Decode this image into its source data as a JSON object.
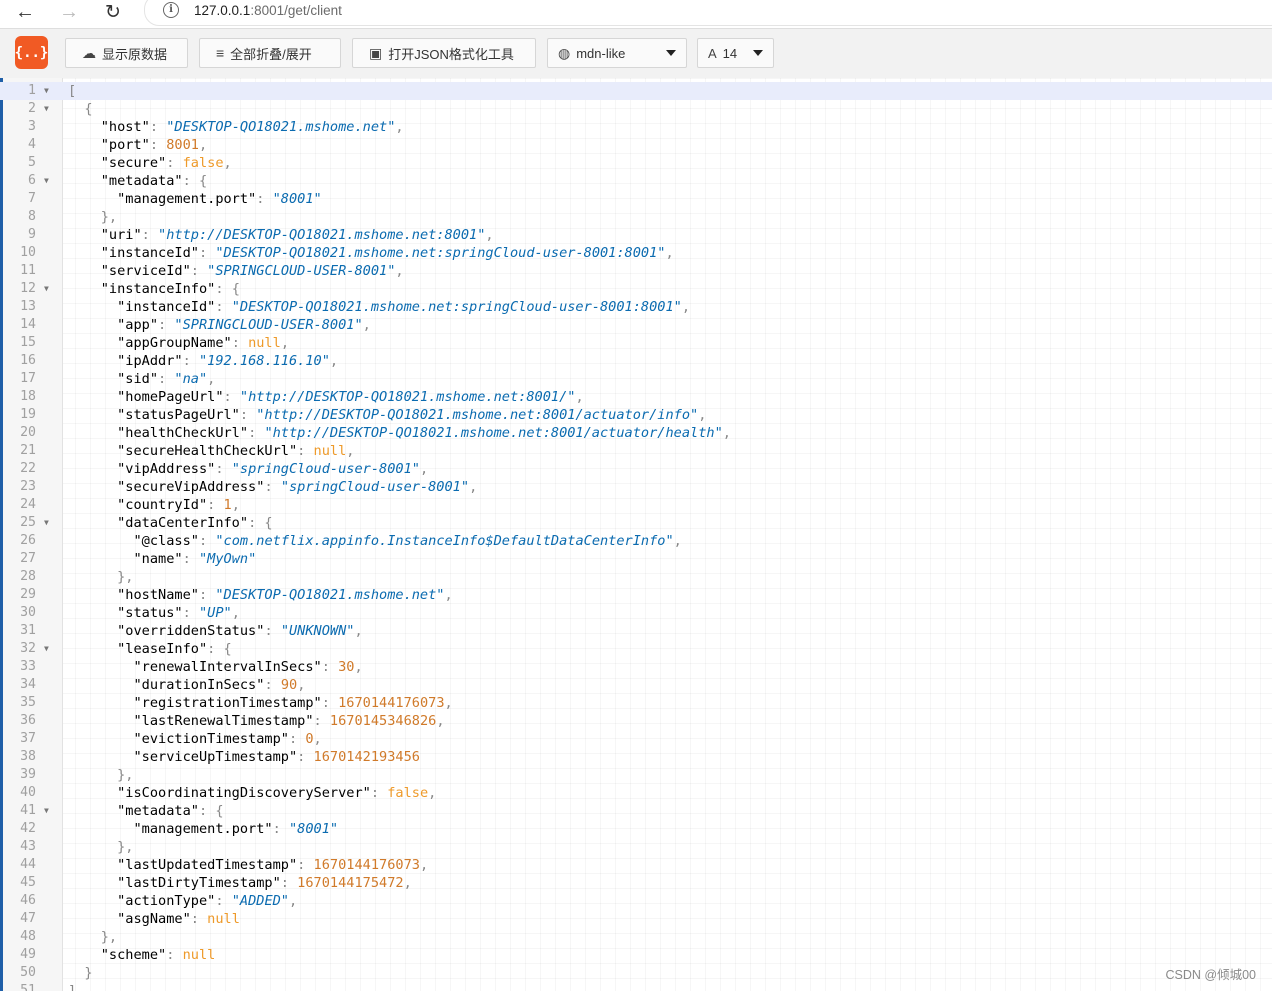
{
  "browser": {
    "url_host": "127.0.0.1",
    "url_path": ":8001/get/client"
  },
  "toolbar": {
    "logo": "{..}",
    "raw_label": "显示原数据",
    "fold_label": "全部折叠/展开",
    "tool_label": "打开JSON格式化工具",
    "theme_value": "mdn-like",
    "font_size_value": "14"
  },
  "editor": {
    "lines": [
      {
        "n": "1",
        "fold": true,
        "indent": 0,
        "parts": [
          [
            "p",
            "["
          ]
        ]
      },
      {
        "n": "2",
        "fold": true,
        "indent": 1,
        "parts": [
          [
            "p",
            "{"
          ]
        ]
      },
      {
        "n": "3",
        "fold": false,
        "indent": 2,
        "parts": [
          [
            "k",
            "\"host\""
          ],
          [
            "p",
            ": "
          ],
          [
            "s",
            "\"DESKTOP-QO18021.mshome.net\""
          ],
          [
            "p",
            ","
          ]
        ]
      },
      {
        "n": "4",
        "fold": false,
        "indent": 2,
        "parts": [
          [
            "k",
            "\"port\""
          ],
          [
            "p",
            ": "
          ],
          [
            "n",
            "8001"
          ],
          [
            "p",
            ","
          ]
        ]
      },
      {
        "n": "5",
        "fold": false,
        "indent": 2,
        "parts": [
          [
            "k",
            "\"secure\""
          ],
          [
            "p",
            ": "
          ],
          [
            "b",
            "false"
          ],
          [
            "p",
            ","
          ]
        ]
      },
      {
        "n": "6",
        "fold": true,
        "indent": 2,
        "parts": [
          [
            "k",
            "\"metadata\""
          ],
          [
            "p",
            ": {"
          ]
        ]
      },
      {
        "n": "7",
        "fold": false,
        "indent": 3,
        "parts": [
          [
            "k",
            "\"management.port\""
          ],
          [
            "p",
            ": "
          ],
          [
            "s",
            "\"8001\""
          ]
        ]
      },
      {
        "n": "8",
        "fold": false,
        "indent": 2,
        "parts": [
          [
            "p",
            "},"
          ]
        ]
      },
      {
        "n": "9",
        "fold": false,
        "indent": 2,
        "parts": [
          [
            "k",
            "\"uri\""
          ],
          [
            "p",
            ": "
          ],
          [
            "s",
            "\"http://DESKTOP-QO18021.mshome.net:8001\""
          ],
          [
            "p",
            ","
          ]
        ]
      },
      {
        "n": "10",
        "fold": false,
        "indent": 2,
        "parts": [
          [
            "k",
            "\"instanceId\""
          ],
          [
            "p",
            ": "
          ],
          [
            "s",
            "\"DESKTOP-QO18021.mshome.net:springCloud-user-8001:8001\""
          ],
          [
            "p",
            ","
          ]
        ]
      },
      {
        "n": "11",
        "fold": false,
        "indent": 2,
        "parts": [
          [
            "k",
            "\"serviceId\""
          ],
          [
            "p",
            ": "
          ],
          [
            "s",
            "\"SPRINGCLOUD-USER-8001\""
          ],
          [
            "p",
            ","
          ]
        ]
      },
      {
        "n": "12",
        "fold": true,
        "indent": 2,
        "parts": [
          [
            "k",
            "\"instanceInfo\""
          ],
          [
            "p",
            ": {"
          ]
        ]
      },
      {
        "n": "13",
        "fold": false,
        "indent": 3,
        "parts": [
          [
            "k",
            "\"instanceId\""
          ],
          [
            "p",
            ": "
          ],
          [
            "s",
            "\"DESKTOP-QO18021.mshome.net:springCloud-user-8001:8001\""
          ],
          [
            "p",
            ","
          ]
        ]
      },
      {
        "n": "14",
        "fold": false,
        "indent": 3,
        "parts": [
          [
            "k",
            "\"app\""
          ],
          [
            "p",
            ": "
          ],
          [
            "s",
            "\"SPRINGCLOUD-USER-8001\""
          ],
          [
            "p",
            ","
          ]
        ]
      },
      {
        "n": "15",
        "fold": false,
        "indent": 3,
        "parts": [
          [
            "k",
            "\"appGroupName\""
          ],
          [
            "p",
            ": "
          ],
          [
            "b",
            "null"
          ],
          [
            "p",
            ","
          ]
        ]
      },
      {
        "n": "16",
        "fold": false,
        "indent": 3,
        "parts": [
          [
            "k",
            "\"ipAddr\""
          ],
          [
            "p",
            ": "
          ],
          [
            "s",
            "\"192.168.116.10\""
          ],
          [
            "p",
            ","
          ]
        ]
      },
      {
        "n": "17",
        "fold": false,
        "indent": 3,
        "parts": [
          [
            "k",
            "\"sid\""
          ],
          [
            "p",
            ": "
          ],
          [
            "s",
            "\"na\""
          ],
          [
            "p",
            ","
          ]
        ]
      },
      {
        "n": "18",
        "fold": false,
        "indent": 3,
        "parts": [
          [
            "k",
            "\"homePageUrl\""
          ],
          [
            "p",
            ": "
          ],
          [
            "s",
            "\"http://DESKTOP-QO18021.mshome.net:8001/\""
          ],
          [
            "p",
            ","
          ]
        ]
      },
      {
        "n": "19",
        "fold": false,
        "indent": 3,
        "parts": [
          [
            "k",
            "\"statusPageUrl\""
          ],
          [
            "p",
            ": "
          ],
          [
            "s",
            "\"http://DESKTOP-QO18021.mshome.net:8001/actuator/info\""
          ],
          [
            "p",
            ","
          ]
        ]
      },
      {
        "n": "20",
        "fold": false,
        "indent": 3,
        "parts": [
          [
            "k",
            "\"healthCheckUrl\""
          ],
          [
            "p",
            ": "
          ],
          [
            "s",
            "\"http://DESKTOP-QO18021.mshome.net:8001/actuator/health\""
          ],
          [
            "p",
            ","
          ]
        ]
      },
      {
        "n": "21",
        "fold": false,
        "indent": 3,
        "parts": [
          [
            "k",
            "\"secureHealthCheckUrl\""
          ],
          [
            "p",
            ": "
          ],
          [
            "b",
            "null"
          ],
          [
            "p",
            ","
          ]
        ]
      },
      {
        "n": "22",
        "fold": false,
        "indent": 3,
        "parts": [
          [
            "k",
            "\"vipAddress\""
          ],
          [
            "p",
            ": "
          ],
          [
            "s",
            "\"springCloud-user-8001\""
          ],
          [
            "p",
            ","
          ]
        ]
      },
      {
        "n": "23",
        "fold": false,
        "indent": 3,
        "parts": [
          [
            "k",
            "\"secureVipAddress\""
          ],
          [
            "p",
            ": "
          ],
          [
            "s",
            "\"springCloud-user-8001\""
          ],
          [
            "p",
            ","
          ]
        ]
      },
      {
        "n": "24",
        "fold": false,
        "indent": 3,
        "parts": [
          [
            "k",
            "\"countryId\""
          ],
          [
            "p",
            ": "
          ],
          [
            "n",
            "1"
          ],
          [
            "p",
            ","
          ]
        ]
      },
      {
        "n": "25",
        "fold": true,
        "indent": 3,
        "parts": [
          [
            "k",
            "\"dataCenterInfo\""
          ],
          [
            "p",
            ": {"
          ]
        ]
      },
      {
        "n": "26",
        "fold": false,
        "indent": 4,
        "parts": [
          [
            "k",
            "\"@class\""
          ],
          [
            "p",
            ": "
          ],
          [
            "s",
            "\"com.netflix.appinfo.InstanceInfo$DefaultDataCenterInfo\""
          ],
          [
            "p",
            ","
          ]
        ]
      },
      {
        "n": "27",
        "fold": false,
        "indent": 4,
        "parts": [
          [
            "k",
            "\"name\""
          ],
          [
            "p",
            ": "
          ],
          [
            "s",
            "\"MyOwn\""
          ]
        ]
      },
      {
        "n": "28",
        "fold": false,
        "indent": 3,
        "parts": [
          [
            "p",
            "},"
          ]
        ]
      },
      {
        "n": "29",
        "fold": false,
        "indent": 3,
        "parts": [
          [
            "k",
            "\"hostName\""
          ],
          [
            "p",
            ": "
          ],
          [
            "s",
            "\"DESKTOP-QO18021.mshome.net\""
          ],
          [
            "p",
            ","
          ]
        ]
      },
      {
        "n": "30",
        "fold": false,
        "indent": 3,
        "parts": [
          [
            "k",
            "\"status\""
          ],
          [
            "p",
            ": "
          ],
          [
            "s",
            "\"UP\""
          ],
          [
            "p",
            ","
          ]
        ]
      },
      {
        "n": "31",
        "fold": false,
        "indent": 3,
        "parts": [
          [
            "k",
            "\"overriddenStatus\""
          ],
          [
            "p",
            ": "
          ],
          [
            "s",
            "\"UNKNOWN\""
          ],
          [
            "p",
            ","
          ]
        ]
      },
      {
        "n": "32",
        "fold": true,
        "indent": 3,
        "parts": [
          [
            "k",
            "\"leaseInfo\""
          ],
          [
            "p",
            ": {"
          ]
        ]
      },
      {
        "n": "33",
        "fold": false,
        "indent": 4,
        "parts": [
          [
            "k",
            "\"renewalIntervalInSecs\""
          ],
          [
            "p",
            ": "
          ],
          [
            "n",
            "30"
          ],
          [
            "p",
            ","
          ]
        ]
      },
      {
        "n": "34",
        "fold": false,
        "indent": 4,
        "parts": [
          [
            "k",
            "\"durationInSecs\""
          ],
          [
            "p",
            ": "
          ],
          [
            "n",
            "90"
          ],
          [
            "p",
            ","
          ]
        ]
      },
      {
        "n": "35",
        "fold": false,
        "indent": 4,
        "parts": [
          [
            "k",
            "\"registrationTimestamp\""
          ],
          [
            "p",
            ": "
          ],
          [
            "n",
            "1670144176073"
          ],
          [
            "p",
            ","
          ]
        ]
      },
      {
        "n": "36",
        "fold": false,
        "indent": 4,
        "parts": [
          [
            "k",
            "\"lastRenewalTimestamp\""
          ],
          [
            "p",
            ": "
          ],
          [
            "n",
            "1670145346826"
          ],
          [
            "p",
            ","
          ]
        ]
      },
      {
        "n": "37",
        "fold": false,
        "indent": 4,
        "parts": [
          [
            "k",
            "\"evictionTimestamp\""
          ],
          [
            "p",
            ": "
          ],
          [
            "n",
            "0"
          ],
          [
            "p",
            ","
          ]
        ]
      },
      {
        "n": "38",
        "fold": false,
        "indent": 4,
        "parts": [
          [
            "k",
            "\"serviceUpTimestamp\""
          ],
          [
            "p",
            ": "
          ],
          [
            "n",
            "1670142193456"
          ]
        ]
      },
      {
        "n": "39",
        "fold": false,
        "indent": 3,
        "parts": [
          [
            "p",
            "},"
          ]
        ]
      },
      {
        "n": "40",
        "fold": false,
        "indent": 3,
        "parts": [
          [
            "k",
            "\"isCoordinatingDiscoveryServer\""
          ],
          [
            "p",
            ": "
          ],
          [
            "b",
            "false"
          ],
          [
            "p",
            ","
          ]
        ]
      },
      {
        "n": "41",
        "fold": true,
        "indent": 3,
        "parts": [
          [
            "k",
            "\"metadata\""
          ],
          [
            "p",
            ": {"
          ]
        ]
      },
      {
        "n": "42",
        "fold": false,
        "indent": 4,
        "parts": [
          [
            "k",
            "\"management.port\""
          ],
          [
            "p",
            ": "
          ],
          [
            "s",
            "\"8001\""
          ]
        ]
      },
      {
        "n": "43",
        "fold": false,
        "indent": 3,
        "parts": [
          [
            "p",
            "},"
          ]
        ]
      },
      {
        "n": "44",
        "fold": false,
        "indent": 3,
        "parts": [
          [
            "k",
            "\"lastUpdatedTimestamp\""
          ],
          [
            "p",
            ": "
          ],
          [
            "n",
            "1670144176073"
          ],
          [
            "p",
            ","
          ]
        ]
      },
      {
        "n": "45",
        "fold": false,
        "indent": 3,
        "parts": [
          [
            "k",
            "\"lastDirtyTimestamp\""
          ],
          [
            "p",
            ": "
          ],
          [
            "n",
            "1670144175472"
          ],
          [
            "p",
            ","
          ]
        ]
      },
      {
        "n": "46",
        "fold": false,
        "indent": 3,
        "parts": [
          [
            "k",
            "\"actionType\""
          ],
          [
            "p",
            ": "
          ],
          [
            "s",
            "\"ADDED\""
          ],
          [
            "p",
            ","
          ]
        ]
      },
      {
        "n": "47",
        "fold": false,
        "indent": 3,
        "parts": [
          [
            "k",
            "\"asgName\""
          ],
          [
            "p",
            ": "
          ],
          [
            "b",
            "null"
          ]
        ]
      },
      {
        "n": "48",
        "fold": false,
        "indent": 2,
        "parts": [
          [
            "p",
            "},"
          ]
        ]
      },
      {
        "n": "49",
        "fold": false,
        "indent": 2,
        "parts": [
          [
            "k",
            "\"scheme\""
          ],
          [
            "p",
            ": "
          ],
          [
            "b",
            "null"
          ]
        ]
      },
      {
        "n": "50",
        "fold": false,
        "indent": 1,
        "parts": [
          [
            "p",
            "}"
          ]
        ]
      },
      {
        "n": "51",
        "fold": false,
        "indent": 0,
        "parts": [
          [
            "p",
            "]"
          ]
        ]
      }
    ]
  },
  "watermark": "CSDN @倾城00",
  "colors": {
    "logo_bg": "#f15a24",
    "key": "#000000",
    "string": "#0b6bb0",
    "number": "#d07a2a",
    "literal": "#ee9a2a",
    "active_line": "#e8ecfb"
  }
}
